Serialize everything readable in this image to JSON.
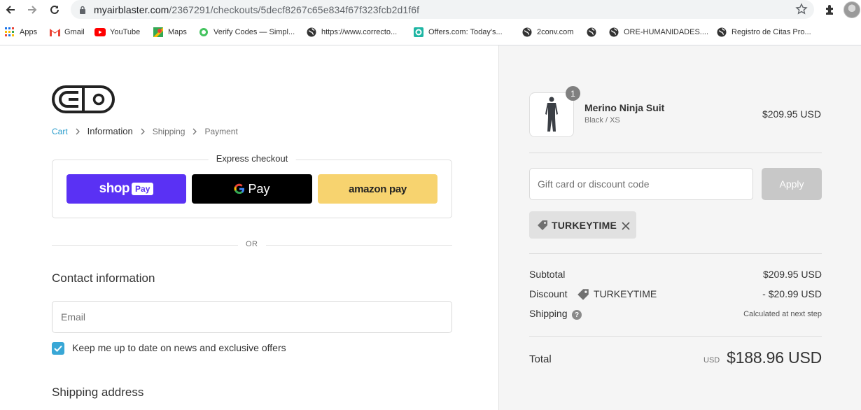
{
  "browser": {
    "url_host": "myairblaster.com",
    "url_path": "/2367291/checkouts/5decf8267c65e834f67f323fcb2d1f6f",
    "bookmarks": [
      {
        "label": "Apps",
        "icon": "apps-grid-icon"
      },
      {
        "label": "Gmail",
        "icon": "gmail-icon"
      },
      {
        "label": "YouTube",
        "icon": "youtube-icon"
      },
      {
        "label": "Maps",
        "icon": "maps-icon"
      },
      {
        "label": "Verify Codes — Simpl...",
        "icon": "verify-codes-icon"
      },
      {
        "label": "https://www.correcto...",
        "icon": "globe-icon"
      },
      {
        "label": "Offers.com: Today's...",
        "icon": "offers-icon"
      },
      {
        "label": "2conv.com",
        "icon": "globe-icon"
      },
      {
        "label": "",
        "icon": "globe-icon"
      },
      {
        "label": "ORE-HUMANIDADES....",
        "icon": "globe-icon"
      },
      {
        "label": "Registro de Citas Pro...",
        "icon": "globe-icon"
      }
    ]
  },
  "checkout": {
    "breadcrumb": {
      "cart": "Cart",
      "information": "Information",
      "shipping": "Shipping",
      "payment": "Payment"
    },
    "express": {
      "title": "Express checkout",
      "shop_pay_word": "shop",
      "shop_pay_badge": "Pay",
      "google_pay_word": "Pay",
      "amazon_pay": "amazon pay"
    },
    "or_text": "OR",
    "contact": {
      "title": "Contact information",
      "email_placeholder": "Email",
      "marketing_label": "Keep me up to date on news and exclusive offers",
      "marketing_checked": true
    },
    "shipping": {
      "title": "Shipping address"
    }
  },
  "summary": {
    "product": {
      "name": "Merino Ninja Suit",
      "variant": "Black / XS",
      "price": "$209.95 USD",
      "quantity": "1"
    },
    "discount_placeholder": "Gift card or discount code",
    "apply_label": "Apply",
    "applied_code": "TURKEYTIME",
    "subtotal_label": "Subtotal",
    "subtotal_value": "$209.95 USD",
    "discount_label": "Discount",
    "discount_code": "TURKEYTIME",
    "discount_value": "- $20.99 USD",
    "shipping_label": "Shipping",
    "shipping_value": "Calculated at next step",
    "total_label": "Total",
    "total_currency": "USD",
    "total_value": "$188.96 USD"
  },
  "colors": {
    "shop_pay": "#5a31f4",
    "google_pay": "#000000",
    "amazon_pay": "#f7d36f",
    "link": "#2a9dcc",
    "checkbox": "#39a7d6"
  }
}
